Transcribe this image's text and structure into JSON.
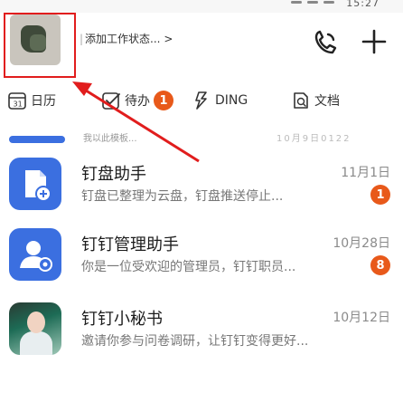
{
  "status_bar": {
    "time": "15:27"
  },
  "header": {
    "status_text": "添加工作状态...",
    "status_chevron": ">"
  },
  "filters": [
    {
      "label": "日历",
      "icon": "calendar-icon"
    },
    {
      "label": "待办",
      "icon": "todo-check-icon",
      "badge": "1"
    },
    {
      "label": "DING",
      "icon": "ding-bolt-icon"
    },
    {
      "label": "文档",
      "icon": "document-icon"
    }
  ],
  "partial_row": {
    "text": "我以此模板...",
    "date": "10月9日0122"
  },
  "messages": [
    {
      "title": "钉盘助手",
      "date": "11月1日",
      "preview": "钉盘已整理为云盘，钉盘推送停止...",
      "badge": "1",
      "avatar_icon": "document-file-icon"
    },
    {
      "title": "钉钉管理助手",
      "date": "10月28日",
      "preview": "你是一位受欢迎的管理员，钉钉职员...",
      "badge": "8",
      "avatar_icon": "admin-person-icon"
    },
    {
      "title": "钉钉小秘书",
      "date": "10月12日",
      "preview": "邀请你参与问卷调研，让钉钉变得更好...",
      "badge": "",
      "avatar_icon": "assistant-photo"
    }
  ],
  "colors": {
    "accent": "#3b6fe0",
    "badge": "#e8591a",
    "annotation": "#e11d1d"
  }
}
